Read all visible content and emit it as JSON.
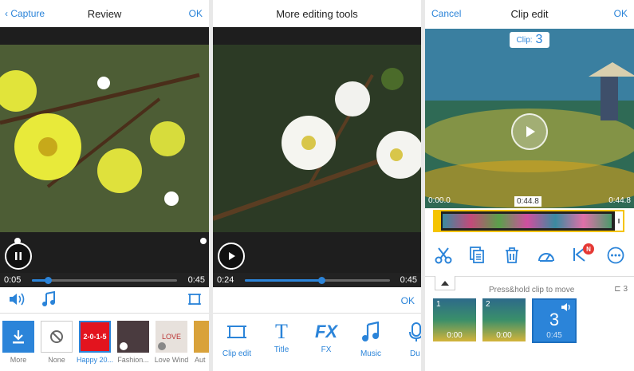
{
  "review": {
    "back_label": "Capture",
    "title": "Review",
    "ok_label": "OK",
    "time_current": "0:05",
    "time_total": "0:45",
    "progress": 0.11,
    "themes": [
      {
        "label": "More"
      },
      {
        "label": "None"
      },
      {
        "label": "Happy 20...",
        "thumb_text": "2-0-1-5"
      },
      {
        "label": "Fashion..."
      },
      {
        "label": "Love Wind",
        "thumb_text": "LOVE"
      },
      {
        "label": "Aut"
      }
    ]
  },
  "editing": {
    "title": "More editing tools",
    "time_current": "0:24",
    "time_total": "0:45",
    "progress": 0.53,
    "ok_label": "OK",
    "tools": [
      {
        "label": "Clip edit",
        "icon": "crop-icon"
      },
      {
        "label": "Title",
        "icon": "title-icon",
        "glyph": "T"
      },
      {
        "label": "FX",
        "icon": "fx-icon",
        "glyph": "FX"
      },
      {
        "label": "Music",
        "icon": "music-note-icon"
      },
      {
        "label": "Du",
        "icon": "dub-icon"
      }
    ]
  },
  "clip_edit": {
    "cancel_label": "Cancel",
    "title": "Clip edit",
    "ok_label": "OK",
    "clip_prefix": "Clip:",
    "clip_number": "3",
    "time_start": "0:00.0",
    "time_mid": "0:44.8",
    "time_end": "0:44.8",
    "badge": "N",
    "press_hint": "Press&hold clip to move",
    "clip_count": "3",
    "clips": [
      {
        "index": "1",
        "time": "0:00"
      },
      {
        "index": "2",
        "time": "0:00"
      },
      {
        "index": "3",
        "time": "0:45"
      }
    ]
  },
  "colors": {
    "accent": "#2b84d9",
    "badge": "#e53935"
  }
}
